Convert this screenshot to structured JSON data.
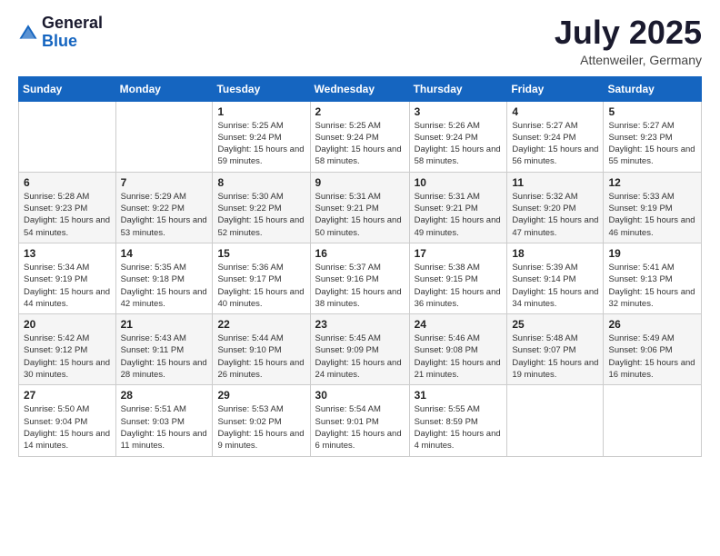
{
  "header": {
    "logo_general": "General",
    "logo_blue": "Blue",
    "title": "July 2025",
    "location": "Attenweiler, Germany"
  },
  "weekdays": [
    "Sunday",
    "Monday",
    "Tuesday",
    "Wednesday",
    "Thursday",
    "Friday",
    "Saturday"
  ],
  "weeks": [
    [
      {
        "day": "",
        "info": ""
      },
      {
        "day": "",
        "info": ""
      },
      {
        "day": "1",
        "info": "Sunrise: 5:25 AM\nSunset: 9:24 PM\nDaylight: 15 hours and 59 minutes."
      },
      {
        "day": "2",
        "info": "Sunrise: 5:25 AM\nSunset: 9:24 PM\nDaylight: 15 hours and 58 minutes."
      },
      {
        "day": "3",
        "info": "Sunrise: 5:26 AM\nSunset: 9:24 PM\nDaylight: 15 hours and 58 minutes."
      },
      {
        "day": "4",
        "info": "Sunrise: 5:27 AM\nSunset: 9:24 PM\nDaylight: 15 hours and 56 minutes."
      },
      {
        "day": "5",
        "info": "Sunrise: 5:27 AM\nSunset: 9:23 PM\nDaylight: 15 hours and 55 minutes."
      }
    ],
    [
      {
        "day": "6",
        "info": "Sunrise: 5:28 AM\nSunset: 9:23 PM\nDaylight: 15 hours and 54 minutes."
      },
      {
        "day": "7",
        "info": "Sunrise: 5:29 AM\nSunset: 9:22 PM\nDaylight: 15 hours and 53 minutes."
      },
      {
        "day": "8",
        "info": "Sunrise: 5:30 AM\nSunset: 9:22 PM\nDaylight: 15 hours and 52 minutes."
      },
      {
        "day": "9",
        "info": "Sunrise: 5:31 AM\nSunset: 9:21 PM\nDaylight: 15 hours and 50 minutes."
      },
      {
        "day": "10",
        "info": "Sunrise: 5:31 AM\nSunset: 9:21 PM\nDaylight: 15 hours and 49 minutes."
      },
      {
        "day": "11",
        "info": "Sunrise: 5:32 AM\nSunset: 9:20 PM\nDaylight: 15 hours and 47 minutes."
      },
      {
        "day": "12",
        "info": "Sunrise: 5:33 AM\nSunset: 9:19 PM\nDaylight: 15 hours and 46 minutes."
      }
    ],
    [
      {
        "day": "13",
        "info": "Sunrise: 5:34 AM\nSunset: 9:19 PM\nDaylight: 15 hours and 44 minutes."
      },
      {
        "day": "14",
        "info": "Sunrise: 5:35 AM\nSunset: 9:18 PM\nDaylight: 15 hours and 42 minutes."
      },
      {
        "day": "15",
        "info": "Sunrise: 5:36 AM\nSunset: 9:17 PM\nDaylight: 15 hours and 40 minutes."
      },
      {
        "day": "16",
        "info": "Sunrise: 5:37 AM\nSunset: 9:16 PM\nDaylight: 15 hours and 38 minutes."
      },
      {
        "day": "17",
        "info": "Sunrise: 5:38 AM\nSunset: 9:15 PM\nDaylight: 15 hours and 36 minutes."
      },
      {
        "day": "18",
        "info": "Sunrise: 5:39 AM\nSunset: 9:14 PM\nDaylight: 15 hours and 34 minutes."
      },
      {
        "day": "19",
        "info": "Sunrise: 5:41 AM\nSunset: 9:13 PM\nDaylight: 15 hours and 32 minutes."
      }
    ],
    [
      {
        "day": "20",
        "info": "Sunrise: 5:42 AM\nSunset: 9:12 PM\nDaylight: 15 hours and 30 minutes."
      },
      {
        "day": "21",
        "info": "Sunrise: 5:43 AM\nSunset: 9:11 PM\nDaylight: 15 hours and 28 minutes."
      },
      {
        "day": "22",
        "info": "Sunrise: 5:44 AM\nSunset: 9:10 PM\nDaylight: 15 hours and 26 minutes."
      },
      {
        "day": "23",
        "info": "Sunrise: 5:45 AM\nSunset: 9:09 PM\nDaylight: 15 hours and 24 minutes."
      },
      {
        "day": "24",
        "info": "Sunrise: 5:46 AM\nSunset: 9:08 PM\nDaylight: 15 hours and 21 minutes."
      },
      {
        "day": "25",
        "info": "Sunrise: 5:48 AM\nSunset: 9:07 PM\nDaylight: 15 hours and 19 minutes."
      },
      {
        "day": "26",
        "info": "Sunrise: 5:49 AM\nSunset: 9:06 PM\nDaylight: 15 hours and 16 minutes."
      }
    ],
    [
      {
        "day": "27",
        "info": "Sunrise: 5:50 AM\nSunset: 9:04 PM\nDaylight: 15 hours and 14 minutes."
      },
      {
        "day": "28",
        "info": "Sunrise: 5:51 AM\nSunset: 9:03 PM\nDaylight: 15 hours and 11 minutes."
      },
      {
        "day": "29",
        "info": "Sunrise: 5:53 AM\nSunset: 9:02 PM\nDaylight: 15 hours and 9 minutes."
      },
      {
        "day": "30",
        "info": "Sunrise: 5:54 AM\nSunset: 9:01 PM\nDaylight: 15 hours and 6 minutes."
      },
      {
        "day": "31",
        "info": "Sunrise: 5:55 AM\nSunset: 8:59 PM\nDaylight: 15 hours and 4 minutes."
      },
      {
        "day": "",
        "info": ""
      },
      {
        "day": "",
        "info": ""
      }
    ]
  ]
}
